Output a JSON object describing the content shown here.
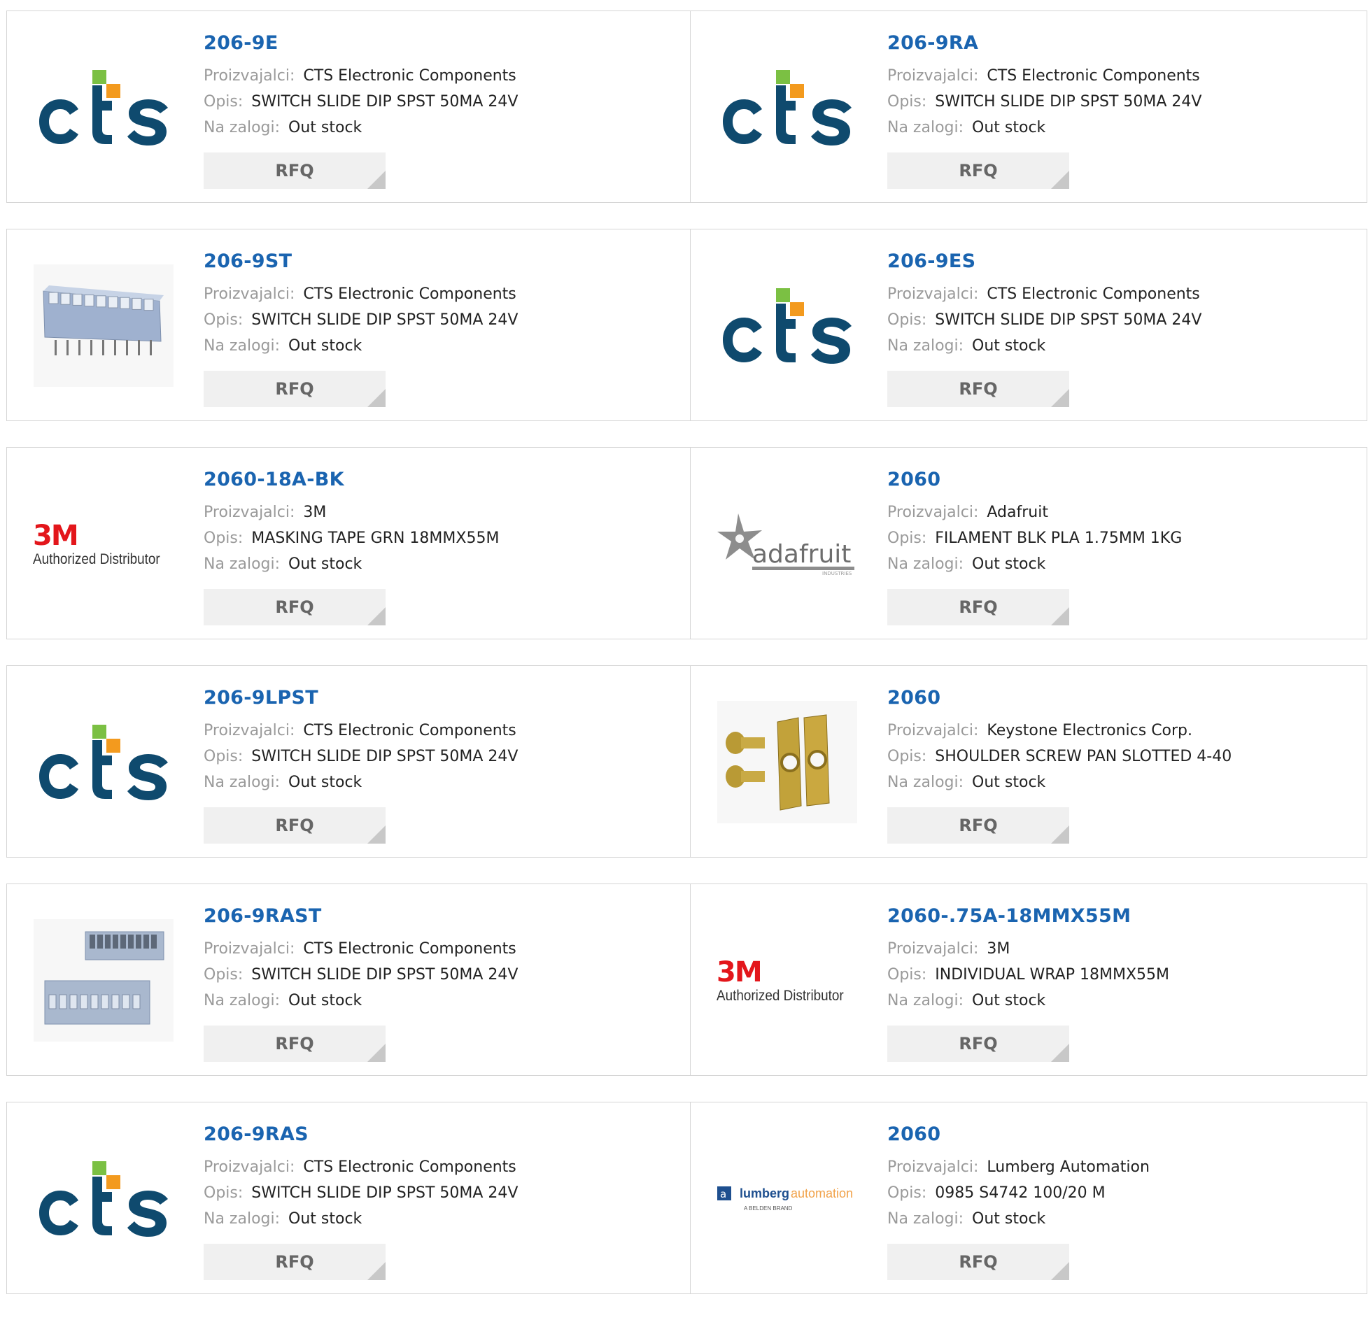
{
  "labels": {
    "manufacturer": "Proizvajalci:",
    "description": "Opis:",
    "stock": "Na zalogi:",
    "rfq": "RFQ"
  },
  "products": [
    {
      "part": "206-9E",
      "manufacturer": "CTS Electronic Components",
      "description": "SWITCH SLIDE DIP SPST 50MA 24V",
      "stock": "Out stock",
      "image": "cts-logo"
    },
    {
      "part": "206-9RA",
      "manufacturer": "CTS Electronic Components",
      "description": "SWITCH SLIDE DIP SPST 50MA 24V",
      "stock": "Out stock",
      "image": "cts-logo"
    },
    {
      "part": "206-9ST",
      "manufacturer": "CTS Electronic Components",
      "description": "SWITCH SLIDE DIP SPST 50MA 24V",
      "stock": "Out stock",
      "image": "dip-switch-photo"
    },
    {
      "part": "206-9ES",
      "manufacturer": "CTS Electronic Components",
      "description": "SWITCH SLIDE DIP SPST 50MA 24V",
      "stock": "Out stock",
      "image": "cts-logo"
    },
    {
      "part": "2060-18A-BK",
      "manufacturer": "3M",
      "description": "MASKING TAPE GRN 18MMX55M",
      "stock": "Out stock",
      "image": "3m-logo"
    },
    {
      "part": "2060",
      "manufacturer": "Adafruit",
      "description": "FILAMENT BLK PLA 1.75MM 1KG",
      "stock": "Out stock",
      "image": "adafruit-logo"
    },
    {
      "part": "206-9LPST",
      "manufacturer": "CTS Electronic Components",
      "description": "SWITCH SLIDE DIP SPST 50MA 24V",
      "stock": "Out stock",
      "image": "cts-logo"
    },
    {
      "part": "2060",
      "manufacturer": "Keystone Electronics Corp.",
      "description": "SHOULDER SCREW PAN SLOTTED 4-40",
      "stock": "Out stock",
      "image": "screw-clips-photo"
    },
    {
      "part": "206-9RAST",
      "manufacturer": "CTS Electronic Components",
      "description": "SWITCH SLIDE DIP SPST 50MA 24V",
      "stock": "Out stock",
      "image": "dip-switch-pair-photo"
    },
    {
      "part": "2060-.75A-18MMX55M",
      "manufacturer": "3M",
      "description": "INDIVIDUAL WRAP 18MMX55M",
      "stock": "Out stock",
      "image": "3m-logo"
    },
    {
      "part": "206-9RAS",
      "manufacturer": "CTS Electronic Components",
      "description": "SWITCH SLIDE DIP SPST 50MA 24V",
      "stock": "Out stock",
      "image": "cts-logo"
    },
    {
      "part": "2060",
      "manufacturer": "Lumberg Automation",
      "description": "0985 S4742 100/20 M",
      "stock": "Out stock",
      "image": "lumberg-logo"
    }
  ],
  "logo_text": {
    "m3_big": "3M",
    "m3_small": "Authorized Distributor",
    "adafruit": "adafruit",
    "adafruit_sub": "INDUSTRIES",
    "lumberg_a": "lumberg",
    "lumberg_b": "automation",
    "lumberg_sub": "A BELDEN BRAND"
  },
  "colors": {
    "link": "#1a64b0",
    "label": "#9a9a9a",
    "border": "#d5d5d5",
    "rfq_bg": "#f0f0f0",
    "cts_blue": "#0f4a6e",
    "cts_green": "#7bc043",
    "cts_orange": "#f39a1e",
    "m3_red": "#e3161b"
  }
}
